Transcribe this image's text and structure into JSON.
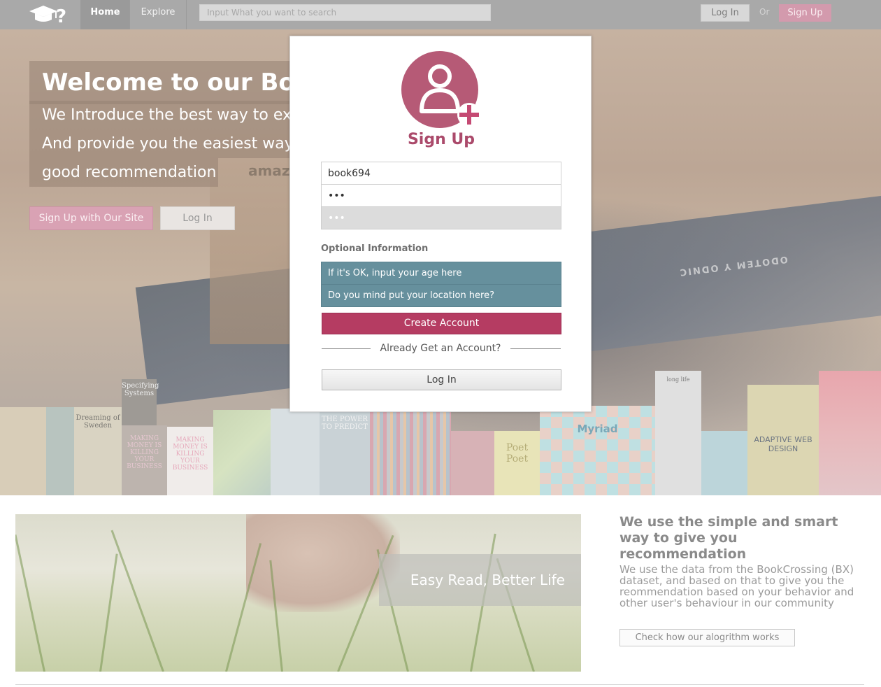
{
  "nav": {
    "logo_icon": "graduation-cap-question-logo",
    "home": "Home",
    "explore": "Explore",
    "search_placeholder": "Input What you want to search",
    "login": "Log In",
    "or": "Or",
    "signup": "Sign Up"
  },
  "hero": {
    "title": "Welcome to our Book",
    "line1": "We Introduce the best way to expl",
    "line2": "And provide you the easiest way t",
    "line3": "good recommendation",
    "signup_button": "Sign Up with Our Site",
    "login_button": "Log In",
    "background_word": "amaz",
    "spine_text": "ODOTEM Y ODNIC",
    "books": [
      {
        "title": "Dreaming of Sweden"
      },
      {
        "title": "Specifying Systems"
      },
      {
        "title": "MAKING MONEY IS KILLING YOUR BUSINESS"
      },
      {
        "title": "MAKING MONEY IS KILLING YOUR BUSINESS"
      },
      {
        "title": "THE POWER TO PREDICT"
      },
      {
        "title": "Poet Poet"
      },
      {
        "title": "Myriad"
      },
      {
        "title": "long life"
      },
      {
        "title": "ADAPTIVE WEB DESIGN"
      }
    ]
  },
  "modal": {
    "icon": "user-add-icon",
    "title": "Sign Up",
    "username_value": "book694",
    "password_value": "•••",
    "password_confirm_value": "•••",
    "optional_label": "Optional Information",
    "age_placeholder": "If it's OK, input your age here",
    "location_placeholder": "Do you mind put your location here?",
    "create_button": "Create Account",
    "already_text": "Already Get an Account?",
    "login_button": "Log In"
  },
  "lower": {
    "slogan": "Easy Read, Better Life",
    "side_title": "We use the simple and smart way to give you recommendation",
    "side_body": "We use the data from the BookCrossing (BX) dataset, and based on that to give you the reommendation based on your behavior and other user's behaviour in our community",
    "side_button": "Check how our alogrithm works"
  },
  "colors": {
    "brand_pink": "#b53c62",
    "teal": "#66909d",
    "nav_gray": "#a9a9a9"
  }
}
